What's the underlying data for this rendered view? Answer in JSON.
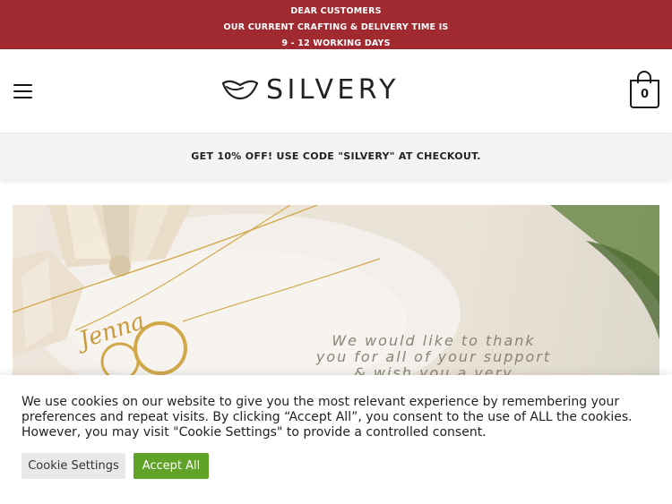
{
  "announcement": {
    "line1": "DEAR CUSTOMERS",
    "line2": "OUR CURRENT CRAFTING & DELIVERY TIME IS",
    "line3": "9 - 12 WORKING DAYS"
  },
  "header": {
    "logo_text": "SILVERY",
    "cart_count": "0"
  },
  "promo": {
    "text": "GET 10% OFF! USE CODE \"SILVERY\" AT CHECKOUT."
  },
  "hero": {
    "necklace_name": "Jenna",
    "line1": "We would like to thank",
    "line2": "you for all of your support",
    "line3": "& wish you a very"
  },
  "cookie_banner": {
    "message": "We use cookies on our website to give you the most relevant experience by remembering your preferences and repeat visits. By clicking “Accept All”, you consent to the use of ALL the cookies. However, you may visit \"Cookie Settings\" to provide a controlled consent.",
    "settings_label": "Cookie Settings",
    "accept_label": "Accept All"
  },
  "colors": {
    "brand_red": "#a12a31",
    "accept_green": "#61a229"
  }
}
